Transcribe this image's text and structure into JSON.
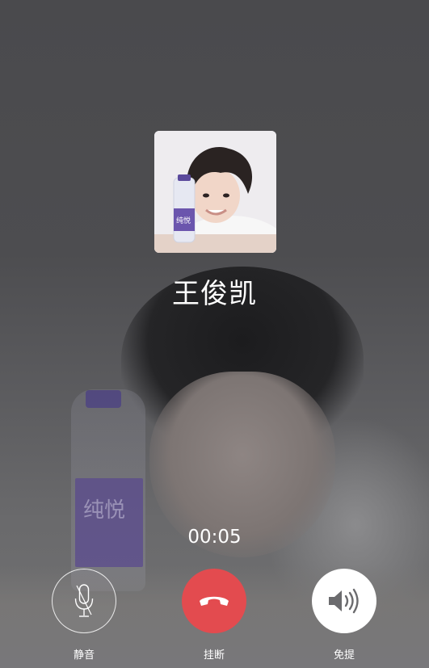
{
  "call": {
    "caller_name": "王俊凯",
    "timer": "00:05"
  },
  "controls": {
    "mute": {
      "label": "静音",
      "icon": "microphone-icon"
    },
    "hangup": {
      "label": "挂断",
      "icon": "phone-hangup-icon"
    },
    "speaker": {
      "label": "免提",
      "icon": "speaker-icon"
    }
  },
  "avatar": {
    "bottle_text": "纯悦"
  },
  "background": {
    "bottle_text": "纯悦"
  },
  "colors": {
    "hangup_red": "#e34b4f",
    "overlay": "#4b4b4e",
    "text": "#ffffff"
  }
}
